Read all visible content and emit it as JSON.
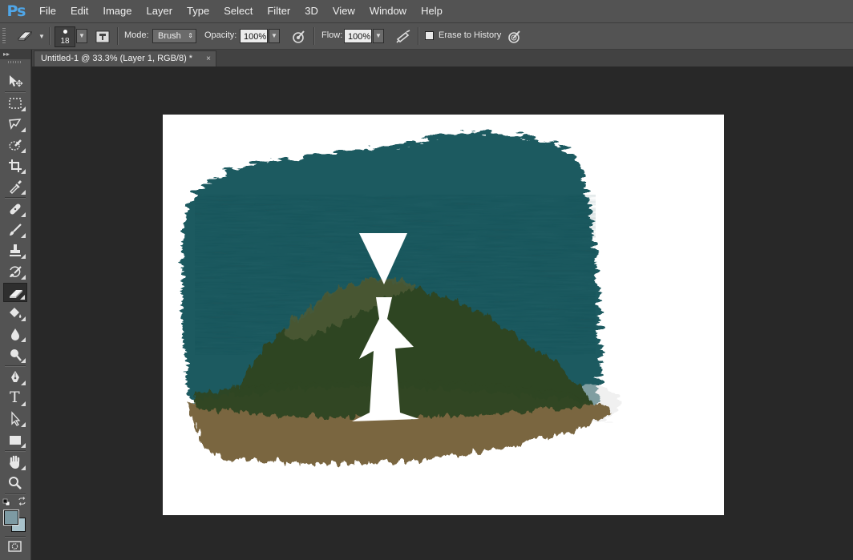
{
  "app": {
    "logo": "Ps"
  },
  "menu": [
    "File",
    "Edit",
    "Image",
    "Layer",
    "Type",
    "Select",
    "Filter",
    "3D",
    "View",
    "Window",
    "Help"
  ],
  "options": {
    "brush_size": "18",
    "mode_label": "Mode:",
    "mode_value": "Brush",
    "opacity_label": "Opacity:",
    "opacity_value": "100%",
    "flow_label": "Flow:",
    "flow_value": "100%",
    "erase_history_label": "Erase to History",
    "erase_history_checked": false
  },
  "document_tab": {
    "title": "Untitled-1 @ 33.3% (Layer 1, RGB/8) *",
    "close": "×"
  },
  "toolbar": {
    "header": "▸▸",
    "tools": [
      "move-tool",
      "rectangular-marquee-tool",
      "lasso-tool",
      "quick-selection-tool",
      "crop-tool",
      "eyedropper-tool",
      "spot-healing-tool",
      "brush-tool",
      "clone-stamp-tool",
      "history-brush-tool",
      "eraser-tool",
      "paint-bucket-tool",
      "blur-tool",
      "dodge-tool",
      "pen-tool",
      "type-tool",
      "path-selection-tool",
      "rectangle-tool",
      "hand-tool",
      "zoom-tool"
    ],
    "active_tool": "eraser-tool",
    "type_tool_glyph": "T"
  },
  "colors": {
    "foreground": "#7d9aa3",
    "background": "#a9c3cc",
    "teal": "#1f5a61",
    "green": "#2f4420",
    "olive": "#4d5a36",
    "brown": "#7a6640",
    "figure": "#ffffff",
    "ps_blue": "#4fa6e8"
  }
}
